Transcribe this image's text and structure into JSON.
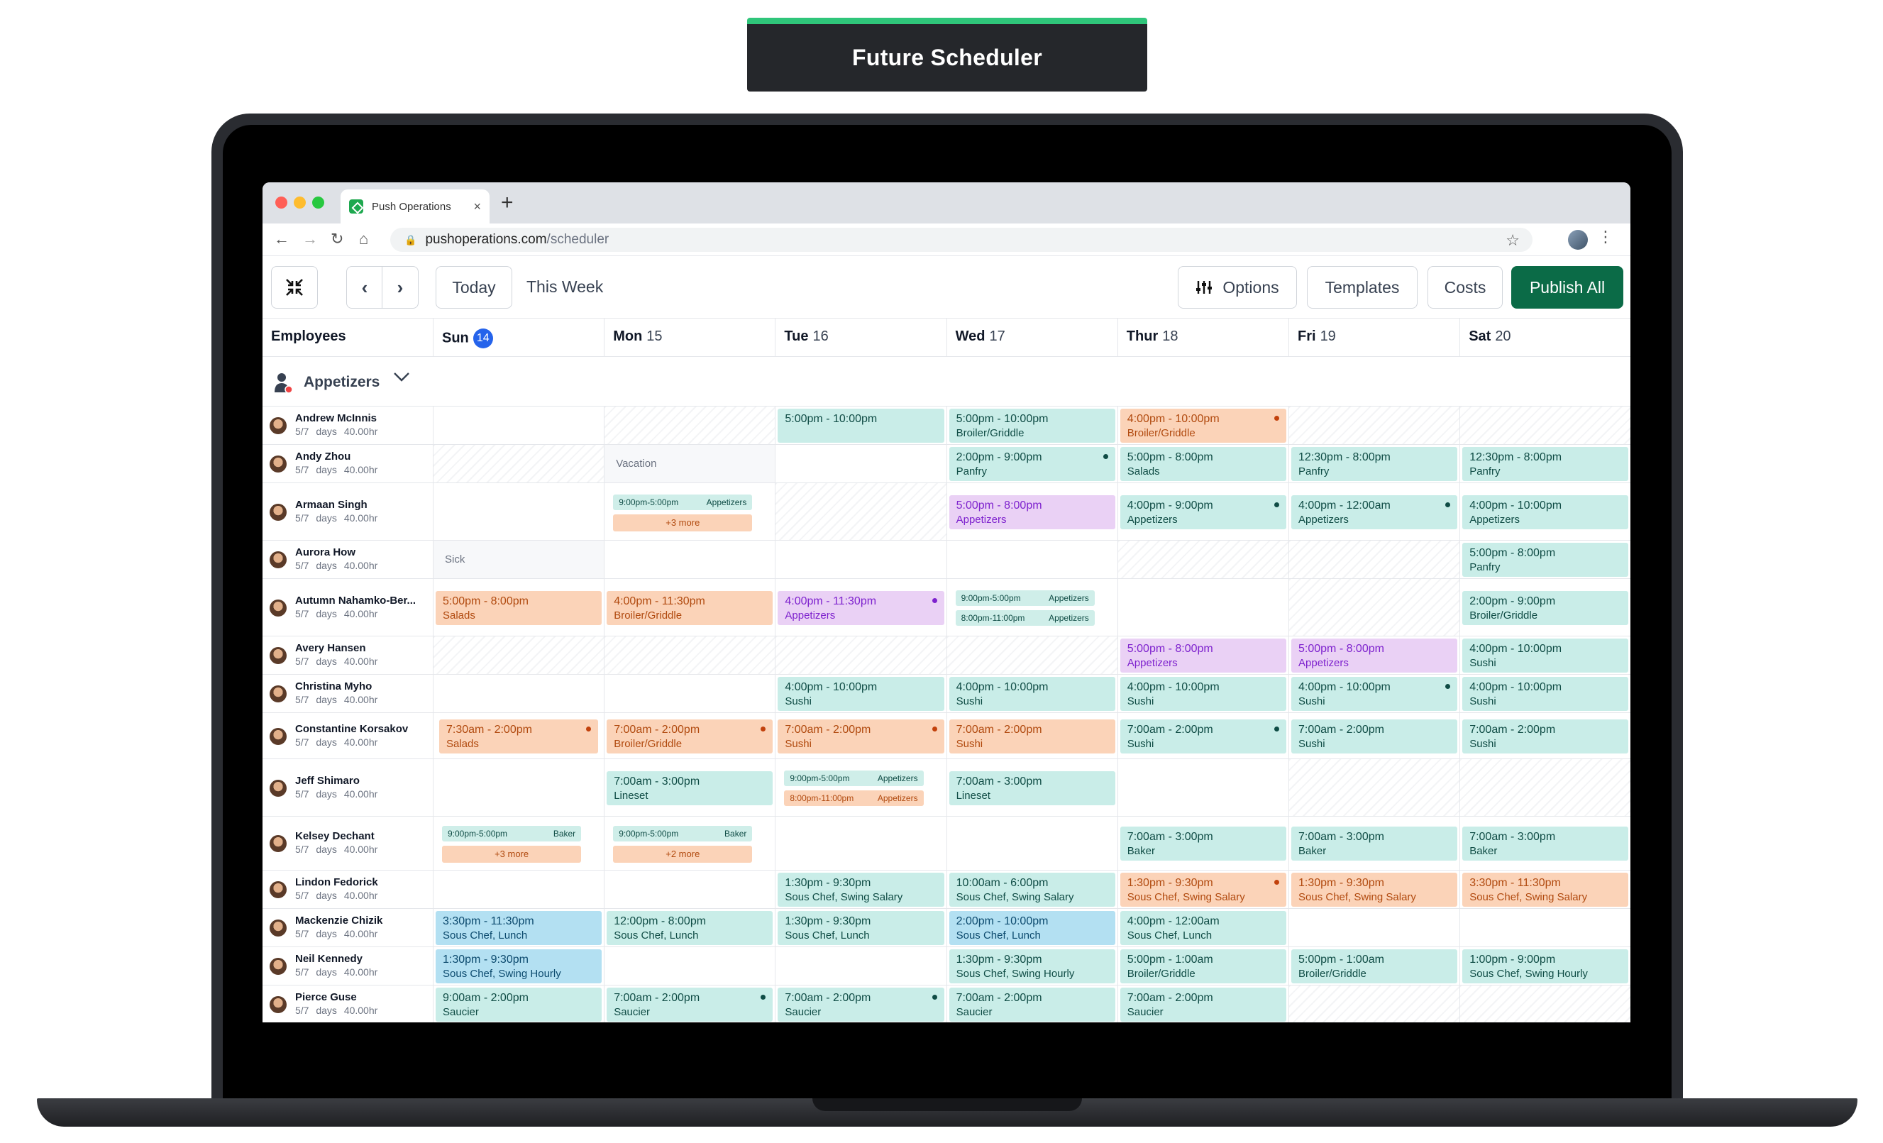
{
  "banner": {
    "title": "Future Scheduler"
  },
  "browser": {
    "tab_title": "Push Operations",
    "tab_close": "×",
    "new_tab": "+",
    "url_host": "pushoperations.com",
    "url_path": "/scheduler"
  },
  "toolbar": {
    "today": "Today",
    "range": "This Week",
    "options": "Options",
    "templates": "Templates",
    "costs": "Costs",
    "publish": "Publish All"
  },
  "header": {
    "employees": "Employees",
    "days": [
      {
        "dow": "Sun",
        "date": "14",
        "today": true
      },
      {
        "dow": "Mon",
        "date": "15"
      },
      {
        "dow": "Tue",
        "date": "16"
      },
      {
        "dow": "Wed",
        "date": "17"
      },
      {
        "dow": "Thur",
        "date": "18"
      },
      {
        "dow": "Fri",
        "date": "19"
      },
      {
        "dow": "Sat",
        "date": "20"
      }
    ]
  },
  "group": {
    "name": "Appetizers"
  },
  "colors": {
    "teal": "#c9ede8",
    "orange": "#fbd3b8",
    "purple": "#ead1f5",
    "blue": "#b3e0f2",
    "publish": "#0b6b47",
    "today_badge": "#2563eb"
  },
  "rows": [
    {
      "name": "Andrew McInnis",
      "meta": "5/7 days 40.00hr",
      "h": 2,
      "cells": [
        {},
        {
          "hatch": true
        },
        {
          "type": "shift",
          "c": "teal",
          "t": "5:00pm - 10:00pm",
          "p": ""
        },
        {
          "type": "shift",
          "c": "teal",
          "t": "5:00pm - 10:00pm",
          "p": "Broiler/Griddle"
        },
        {
          "type": "shift",
          "c": "orange",
          "t": "4:00pm - 10:00pm",
          "p": "Broiler/Griddle",
          "dot": true
        },
        {
          "hatch": true
        },
        {
          "hatch": true
        }
      ]
    },
    {
      "name": "Andy Zhou",
      "meta": "5/7 days 40.00hr",
      "h": 2,
      "cells": [
        {
          "hatch": true
        },
        {
          "type": "text",
          "gray": true,
          "text": "Vacation"
        },
        {},
        {
          "type": "shift",
          "c": "teal",
          "t": "2:00pm - 9:00pm",
          "p": "Panfry",
          "dot": true
        },
        {
          "type": "shift",
          "c": "teal",
          "t": "5:00pm - 8:00pm",
          "p": "Salads"
        },
        {
          "type": "shift",
          "c": "teal",
          "t": "12:30pm - 8:00pm",
          "p": "Panfry"
        },
        {
          "type": "shift",
          "c": "teal",
          "t": "12:30pm - 8:00pm",
          "p": "Panfry"
        }
      ]
    },
    {
      "name": "Armaan Singh",
      "meta": "5/7 days 40.00hr",
      "h": 3,
      "cells": [
        {},
        {
          "type": "multi",
          "minis": [
            {
              "t": "9:00pm-5:00pm",
              "p": "Appetizers",
              "c": "teal"
            }
          ],
          "more": "+3 more"
        },
        {
          "hatch": true
        },
        {
          "type": "shift",
          "c": "purple",
          "t": "5:00pm - 8:00pm",
          "p": "Appetizers"
        },
        {
          "type": "shift",
          "c": "teal",
          "t": "4:00pm - 9:00pm",
          "p": "Appetizers",
          "dot": true
        },
        {
          "type": "shift",
          "c": "teal",
          "t": "4:00pm - 12:00am",
          "p": "Appetizers",
          "dot": true
        },
        {
          "type": "shift",
          "c": "teal",
          "t": "4:00pm - 10:00pm",
          "p": "Appetizers"
        }
      ]
    },
    {
      "name": "Aurora How",
      "meta": "5/7 days 40.00hr",
      "h": 2,
      "cells": [
        {
          "type": "text",
          "gray": true,
          "text": "Sick"
        },
        {},
        {},
        {},
        {
          "hatch": true
        },
        {
          "hatch": true
        },
        {
          "type": "shift",
          "c": "teal",
          "t": "5:00pm - 8:00pm",
          "p": "Panfry"
        }
      ]
    },
    {
      "name": "Autumn Nahamko-Ber...",
      "meta": "5/7 days 40.00hr",
      "h": 3,
      "cells": [
        {
          "type": "shift",
          "c": "orange",
          "t": "5:00pm - 8:00pm",
          "p": "Salads"
        },
        {
          "type": "shift",
          "c": "orange",
          "t": "4:00pm - 11:30pm",
          "p": "Broiler/Griddle"
        },
        {
          "type": "shift",
          "c": "purple",
          "t": "4:00pm - 11:30pm",
          "p": "Appetizers",
          "dot": true
        },
        {
          "type": "multi",
          "minis": [
            {
              "t": "9:00pm-5:00pm",
              "p": "Appetizers",
              "c": "teal"
            },
            {
              "t": "8:00pm-11:00pm",
              "p": "Appetizers",
              "c": "teal"
            }
          ]
        },
        {},
        {
          "hatch": true
        },
        {
          "type": "shift",
          "c": "teal",
          "t": "2:00pm - 9:00pm",
          "p": "Broiler/Griddle"
        }
      ]
    },
    {
      "name": "Avery Hansen",
      "meta": "5/7 days 40.00hr",
      "h": 2,
      "cells": [
        {
          "hatch": true
        },
        {
          "hatch": true
        },
        {
          "hatch": true
        },
        {
          "hatch": true
        },
        {
          "type": "shift",
          "c": "purple",
          "t": "5:00pm - 8:00pm",
          "p": "Appetizers"
        },
        {
          "type": "shift",
          "c": "purple",
          "t": "5:00pm - 8:00pm",
          "p": "Appetizers"
        },
        {
          "type": "shift",
          "c": "teal",
          "t": "4:00pm - 10:00pm",
          "p": "Sushi"
        }
      ]
    },
    {
      "name": "Christina Myho",
      "meta": "5/7 days 40.00hr",
      "h": 2,
      "cells": [
        {},
        {},
        {
          "type": "shift",
          "c": "teal",
          "t": "4:00pm - 10:00pm",
          "p": "Sushi"
        },
        {
          "type": "shift",
          "c": "teal",
          "t": "4:00pm - 10:00pm",
          "p": "Sushi"
        },
        {
          "type": "shift",
          "c": "teal",
          "t": "4:00pm - 10:00pm",
          "p": "Sushi"
        },
        {
          "type": "shift",
          "c": "teal",
          "t": "4:00pm - 10:00pm",
          "p": "Sushi",
          "dot": true
        },
        {
          "type": "shift",
          "c": "teal",
          "t": "4:00pm - 10:00pm",
          "p": "Sushi"
        }
      ]
    },
    {
      "name": "Constantine Korsakov",
      "meta": "5/7 days 40.00hr",
      "h": 2.4,
      "cells": [
        {
          "type": "shift",
          "c": "orange",
          "t": "7:30am - 2:00pm",
          "p": "Salads",
          "dot": true,
          "inset": true
        },
        {
          "type": "shift",
          "c": "orange",
          "t": "7:00am - 2:00pm",
          "p": "Broiler/Griddle",
          "dot": true
        },
        {
          "type": "shift",
          "c": "orange",
          "t": "7:00am - 2:00pm",
          "p": "Sushi",
          "dot": true
        },
        {
          "type": "shift",
          "c": "orange",
          "t": "7:00am - 2:00pm",
          "p": "Sushi"
        },
        {
          "type": "shift",
          "c": "teal",
          "t": "7:00am - 2:00pm",
          "p": "Sushi",
          "dot": true
        },
        {
          "type": "shift",
          "c": "teal",
          "t": "7:00am - 2:00pm",
          "p": "Sushi"
        },
        {
          "type": "shift",
          "c": "teal",
          "t": "7:00am - 2:00pm",
          "p": "Sushi"
        }
      ]
    },
    {
      "name": "Jeff Shimaro",
      "meta": "5/7 days 40.00hr",
      "h": 3,
      "cells": [
        {},
        {
          "type": "shift",
          "c": "teal",
          "t": "7:00am - 3:00pm",
          "p": "Lineset"
        },
        {
          "type": "multi",
          "minis": [
            {
              "t": "9:00pm-5:00pm",
              "p": "Appetizers",
              "c": "teal"
            },
            {
              "t": "8:00pm-11:00pm",
              "p": "Appetizers",
              "c": "orange"
            }
          ]
        },
        {
          "type": "shift",
          "c": "teal",
          "t": "7:00am - 3:00pm",
          "p": "Lineset"
        },
        {},
        {
          "hatch": true
        },
        {
          "hatch": true
        }
      ]
    },
    {
      "name": "Kelsey Dechant",
      "meta": "5/7 days 40.00hr",
      "h": 2.8,
      "cells": [
        {
          "type": "multi",
          "minis": [
            {
              "t": "9:00pm-5:00pm",
              "p": "Baker",
              "c": "teal"
            }
          ],
          "more": "+3 more"
        },
        {
          "type": "multi",
          "minis": [
            {
              "t": "9:00pm-5:00pm",
              "p": "Baker",
              "c": "teal"
            }
          ],
          "more": "+2 more"
        },
        {},
        {},
        {
          "type": "shift",
          "c": "teal",
          "t": "7:00am - 3:00pm",
          "p": "Baker"
        },
        {
          "type": "shift",
          "c": "teal",
          "t": "7:00am - 3:00pm",
          "p": "Baker"
        },
        {
          "type": "shift",
          "c": "teal",
          "t": "7:00am - 3:00pm",
          "p": "Baker"
        }
      ]
    },
    {
      "name": "Lindon Fedorick",
      "meta": "5/7 days 40.00hr",
      "h": 2,
      "cells": [
        {},
        {},
        {
          "type": "shift",
          "c": "teal",
          "t": "1:30pm - 9:30pm",
          "p": "Sous Chef, Swing Salary"
        },
        {
          "type": "shift",
          "c": "teal",
          "t": "10:00am - 6:00pm",
          "p": "Sous Chef, Swing Salary"
        },
        {
          "type": "shift",
          "c": "orange",
          "t": "1:30pm - 9:30pm",
          "p": "Sous Chef, Swing Salary",
          "dot": true
        },
        {
          "type": "shift",
          "c": "orange",
          "t": "1:30pm - 9:30pm",
          "p": "Sous Chef, Swing Salary"
        },
        {
          "type": "shift",
          "c": "orange",
          "t": "3:30pm - 11:30pm",
          "p": "Sous Chef, Swing Salary"
        }
      ]
    },
    {
      "name": "Mackenzie Chizik",
      "meta": "5/7 days 40.00hr",
      "h": 2,
      "cells": [
        {
          "type": "shift",
          "c": "blue",
          "t": "3:30pm - 11:30pm",
          "p": "Sous Chef, Lunch"
        },
        {
          "type": "shift",
          "c": "teal",
          "t": "12:00pm - 8:00pm",
          "p": "Sous Chef, Lunch"
        },
        {
          "type": "shift",
          "c": "teal",
          "t": "1:30pm - 9:30pm",
          "p": "Sous Chef, Lunch"
        },
        {
          "type": "shift",
          "c": "blue",
          "t": "2:00pm - 10:00pm",
          "p": "Sous Chef, Lunch"
        },
        {
          "type": "shift",
          "c": "teal",
          "t": "4:00pm - 12:00am",
          "p": "Sous Chef, Lunch"
        },
        {},
        {}
      ]
    },
    {
      "name": "Neil Kennedy",
      "meta": "5/7 days 40.00hr",
      "h": 2,
      "cells": [
        {
          "type": "shift",
          "c": "blue",
          "t": "1:30pm - 9:30pm",
          "p": "Sous Chef, Swing Hourly"
        },
        {},
        {},
        {
          "type": "shift",
          "c": "teal",
          "t": "1:30pm - 9:30pm",
          "p": "Sous Chef, Swing Hourly"
        },
        {
          "type": "shift",
          "c": "teal",
          "t": "5:00pm - 1:00am",
          "p": "Broiler/Griddle"
        },
        {
          "type": "shift",
          "c": "teal",
          "t": "5:00pm - 1:00am",
          "p": "Broiler/Griddle"
        },
        {
          "type": "shift",
          "c": "teal",
          "t": "1:00pm - 9:00pm",
          "p": "Sous Chef, Swing Hourly"
        }
      ]
    },
    {
      "name": "Pierce Guse",
      "meta": "5/7 days 40.00hr",
      "h": 2,
      "cells": [
        {
          "type": "shift",
          "c": "teal",
          "t": "9:00am - 2:00pm",
          "p": "Saucier"
        },
        {
          "type": "shift",
          "c": "teal",
          "t": "7:00am - 2:00pm",
          "p": "Saucier",
          "dot": true
        },
        {
          "type": "shift",
          "c": "teal",
          "t": "7:00am - 2:00pm",
          "p": "Saucier",
          "dot": true
        },
        {
          "type": "shift",
          "c": "teal",
          "t": "7:00am - 2:00pm",
          "p": "Saucier"
        },
        {
          "type": "shift",
          "c": "teal",
          "t": "7:00am - 2:00pm",
          "p": "Saucier"
        },
        {
          "hatch": true
        },
        {
          "hatch": true
        }
      ]
    }
  ]
}
